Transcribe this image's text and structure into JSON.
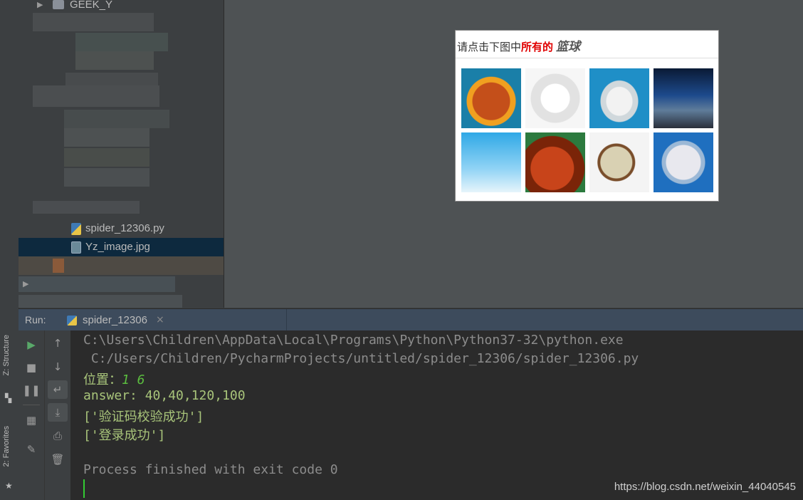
{
  "side_tabs": {
    "structure": "Z: Structure",
    "favorites": "2: Favorites"
  },
  "tree": {
    "root_label": "GEEK_Y",
    "files": [
      {
        "name": "spider_12306.py",
        "type": "python"
      },
      {
        "name": "Yz_image.jpg",
        "type": "image",
        "selected": true
      }
    ]
  },
  "captcha": {
    "prompt_prefix": "请点击下图中",
    "prompt_highlight": "所有的",
    "prompt_keyword": "篮球",
    "colors": {
      "highlight": "#e00000"
    }
  },
  "run": {
    "label": "Run:",
    "tab_name": "spider_12306",
    "tab_close": "×"
  },
  "console": {
    "line1": "C:\\Users\\Children\\AppData\\Local\\Programs\\Python\\Python37-32\\python.exe",
    "line2": " C:/Users/Children/PycharmProjects/untitled/spider_12306/spider_12306.py",
    "pos_label": "位置：",
    "pos_value": "1 6",
    "answer": "answer: 40,40,120,100",
    "verify": "['验证码校验成功']",
    "login": "['登录成功']",
    "exit": "Process finished with exit code 0"
  },
  "watermark": "https://blog.csdn.net/weixin_44040545",
  "colors": {
    "console_bg": "#2b2b2b",
    "selected_row": "#0d293e",
    "run_header": "#3d4b5c",
    "output_text": "#a8c47a",
    "gray_text": "#8c8c8c"
  }
}
